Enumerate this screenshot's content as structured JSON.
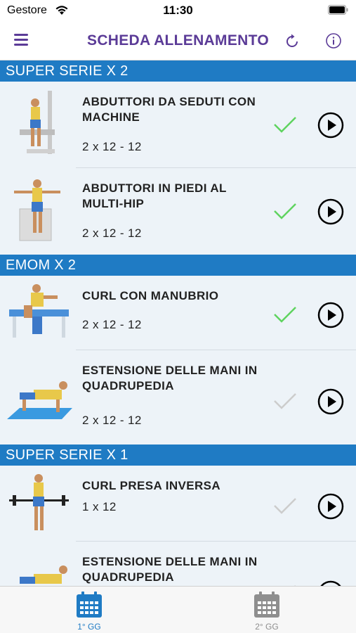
{
  "status": {
    "carrier": "Gestore",
    "time": "11:30"
  },
  "nav": {
    "title": "SCHEDA ALLENAMENTO",
    "menu_icon": "hamburger-icon",
    "refresh_icon": "refresh-icon",
    "info_icon": "info-icon"
  },
  "colors": {
    "accent": "#5b3b97",
    "section": "#1f7bc4",
    "check_done": "#5fd35f",
    "check_pending": "#cccccc",
    "tab_active": "#1f7bc4",
    "tab_inactive": "#8e8e8e"
  },
  "sections": [
    {
      "title": "SUPER SERIE X 2",
      "exercises": [
        {
          "name": "ABDUTTORI DA SEDUTI CON MACHINE",
          "reps": "2 x 12 - 12",
          "done": true
        },
        {
          "name": "ABDUTTORI IN PIEDI AL MULTI-HIP",
          "reps": "2 x 12 - 12",
          "done": true
        }
      ]
    },
    {
      "title": "EMOM X 2",
      "exercises": [
        {
          "name": "CURL CON MANUBRIO",
          "reps": "2 x 12 - 12",
          "done": true
        },
        {
          "name": "ESTENSIONE DELLE MANI IN QUADRUPEDIA",
          "reps": "2 x 12 - 12",
          "done": false
        }
      ]
    },
    {
      "title": "SUPER SERIE X 1",
      "exercises": [
        {
          "name": "CURL PRESA INVERSA",
          "reps": "1 x 12",
          "done": false
        },
        {
          "name": "ESTENSIONE DELLE MANI IN QUADRUPEDIA",
          "reps": "",
          "done": false
        }
      ]
    }
  ],
  "tabs": [
    {
      "label": "1° GG",
      "active": true
    },
    {
      "label": "2° GG",
      "active": false
    }
  ]
}
